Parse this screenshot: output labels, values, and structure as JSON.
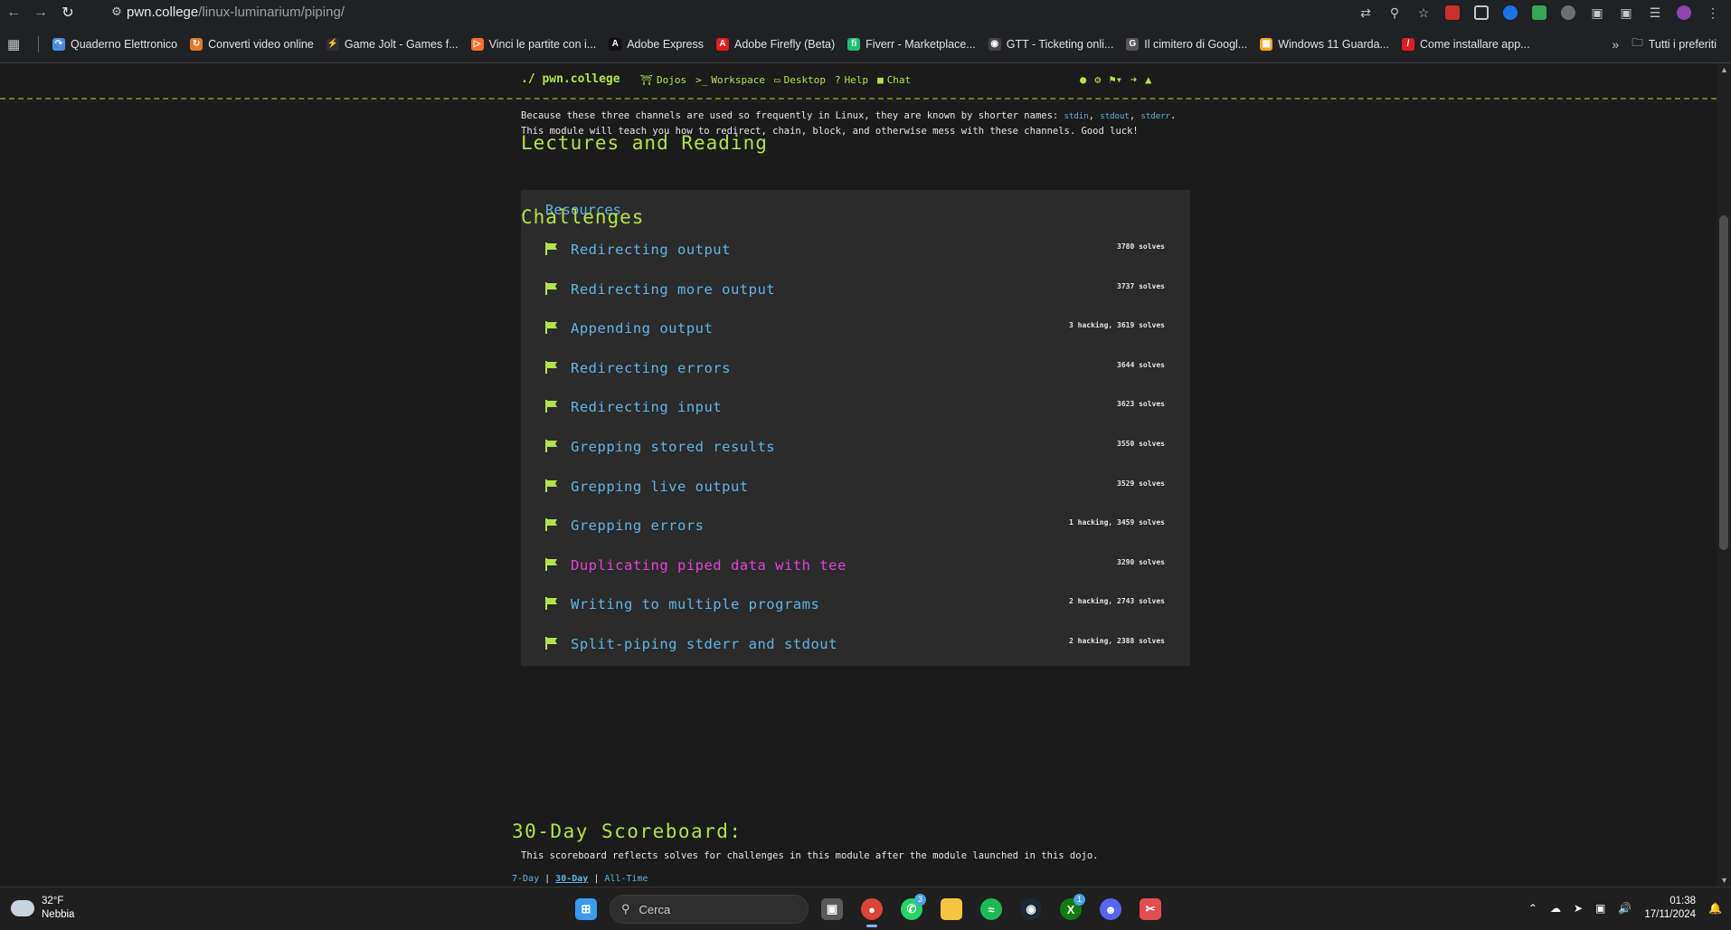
{
  "browser": {
    "url_host": "pwn.college",
    "url_path": "/linux-luminarium/piping/",
    "bookmarks": [
      {
        "label": "Quaderno Elettronico",
        "color": "#4a8ee0",
        "glyph": "↷"
      },
      {
        "label": "Converti video online",
        "color": "#e07a2a",
        "glyph": "↻"
      },
      {
        "label": "Game Jolt - Games f...",
        "color": "#2f2f2f",
        "glyph": "⚡"
      },
      {
        "label": "Vinci le partite con i...",
        "color": "#ff6b2b",
        "glyph": "▷"
      },
      {
        "label": "Adobe Express",
        "color": "#111111",
        "glyph": "A"
      },
      {
        "label": "Adobe Firefly (Beta)",
        "color": "#e01e1e",
        "glyph": "A"
      },
      {
        "label": "Fiverr - Marketplace...",
        "color": "#1dbf73",
        "glyph": "fi"
      },
      {
        "label": "GTT - Ticketing onli...",
        "color": "#444444",
        "glyph": "◉"
      },
      {
        "label": "Il cimitero di Googl...",
        "color": "#555555",
        "glyph": "G"
      },
      {
        "label": "Windows 11 Guarda...",
        "color": "#f5a623",
        "glyph": "▦"
      },
      {
        "label": "Come installare app...",
        "color": "#e01e1e",
        "glyph": "/"
      }
    ],
    "all_bookmarks_label": "Tutti i preferiti"
  },
  "site": {
    "brand": "./ pwn.college",
    "nav": [
      {
        "label": "Dojos",
        "icon": "dojo-icon",
        "glyph": "⛩"
      },
      {
        "label": "Workspace",
        "icon": "terminal-icon",
        "glyph": ">_"
      },
      {
        "label": "Desktop",
        "icon": "desktop-icon",
        "glyph": "▭"
      },
      {
        "label": "Help",
        "icon": "help-icon",
        "glyph": "?"
      },
      {
        "label": "Chat",
        "icon": "chat-icon",
        "glyph": "■"
      }
    ]
  },
  "intro": {
    "line1_a": "Because these three channels are used so frequently in Linux, they are known by shorter names: ",
    "stdin": "stdin",
    "stdout": "stdout",
    "stderr": "stderr",
    "line2": "This module will teach you how to redirect, chain, block, and otherwise mess with these channels. Good luck!"
  },
  "lectures": {
    "title": "Lectures and Reading",
    "resource_label": "Resources"
  },
  "challenges": {
    "title": "Challenges",
    "items": [
      {
        "title": "Redirecting output",
        "meta": "3780 solves",
        "highlight": false
      },
      {
        "title": "Redirecting more output",
        "meta": "3737 solves",
        "highlight": false
      },
      {
        "title": "Appending output",
        "meta": "3 hacking, 3619 solves",
        "highlight": false
      },
      {
        "title": "Redirecting errors",
        "meta": "3644 solves",
        "highlight": false
      },
      {
        "title": "Redirecting input",
        "meta": "3623 solves",
        "highlight": false
      },
      {
        "title": "Grepping stored results",
        "meta": "3550 solves",
        "highlight": false
      },
      {
        "title": "Grepping live output",
        "meta": "3529 solves",
        "highlight": false
      },
      {
        "title": "Grepping errors",
        "meta": "1 hacking, 3459 solves",
        "highlight": false
      },
      {
        "title": "Duplicating piped data with tee",
        "meta": "3290 solves",
        "highlight": true
      },
      {
        "title": "Writing to multiple programs",
        "meta": "2 hacking, 2743 solves",
        "highlight": false
      },
      {
        "title": "Split-piping stderr and stdout",
        "meta": "2 hacking, 2388 solves",
        "highlight": false
      }
    ]
  },
  "scoreboard": {
    "title": "30-Day Scoreboard:",
    "description": "This scoreboard reflects solves for challenges in this module after the module launched in this dojo.",
    "tabs": [
      "7-Day",
      "30-Day",
      "All-Time"
    ],
    "active_tab": "30-Day"
  },
  "taskbar": {
    "temperature": "32°F",
    "weather": "Nebbia",
    "search_placeholder": "Cerca",
    "time": "01:38",
    "date": "17/11/2024",
    "whatsapp_badge": "3",
    "xbox_badge": "1"
  },
  "colors": {
    "accent_green": "#b3e24b",
    "link_blue": "#5fb3e6",
    "highlight_magenta": "#e540d8",
    "card_bg": "#2b2b2b",
    "page_bg": "#1b1b1b"
  }
}
